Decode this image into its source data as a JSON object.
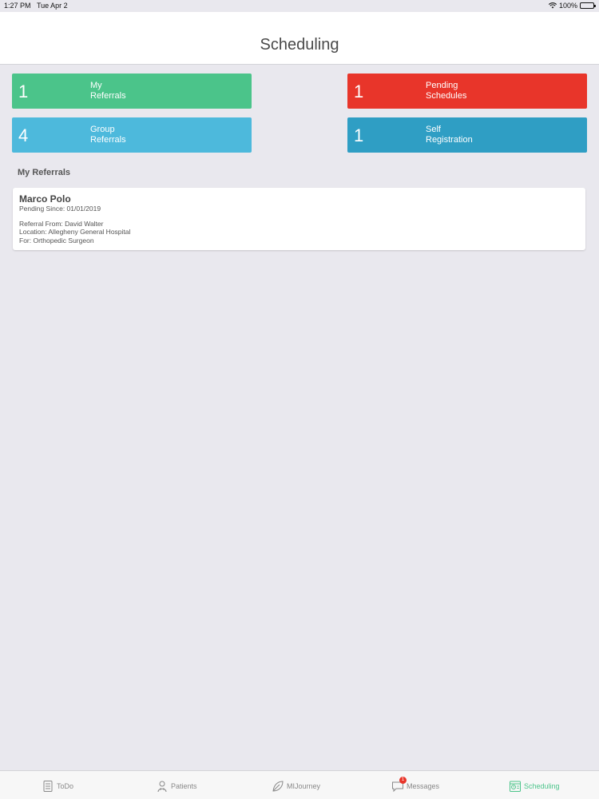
{
  "status_bar": {
    "time": "1:27 PM",
    "date": "Tue Apr 2",
    "battery": "100%"
  },
  "header": {
    "title": "Scheduling"
  },
  "tiles": [
    {
      "count": "1",
      "label_line1": "My",
      "label_line2": "Referrals",
      "color": "#4bc48a"
    },
    {
      "count": "1",
      "label_line1": "Pending",
      "label_line2": "Schedules",
      "color": "#e8352a"
    },
    {
      "count": "4",
      "label_line1": "Group",
      "label_line2": "Referrals",
      "color": "#4db9dc"
    },
    {
      "count": "1",
      "label_line1": "Self",
      "label_line2": "Registration",
      "color": "#2f9ec4"
    }
  ],
  "section": {
    "title": "My Referrals"
  },
  "referrals": [
    {
      "name": "Marco Polo",
      "pending_since": "Pending Since: 01/01/2019",
      "referral_from": "Referral From:  David  Walter",
      "location": "Location: Allegheny General Hospital",
      "for": "For: Orthopedic Surgeon"
    }
  ],
  "tabbar": {
    "items": [
      {
        "label": "ToDo",
        "icon": "todo-icon"
      },
      {
        "label": "Patients",
        "icon": "patients-icon"
      },
      {
        "label": "MIJourney",
        "icon": "leaf-icon"
      },
      {
        "label": "Messages",
        "icon": "messages-icon",
        "badge": "1"
      },
      {
        "label": "Scheduling",
        "icon": "scheduling-icon",
        "active": true
      }
    ]
  },
  "colors": {
    "accent": "#4bc48a",
    "badge": "#e8352a"
  }
}
